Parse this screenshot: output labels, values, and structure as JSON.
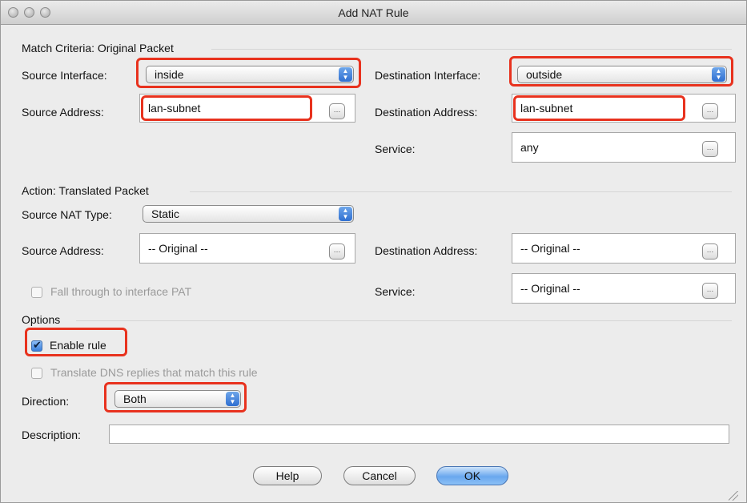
{
  "window": {
    "title": "Add NAT Rule"
  },
  "match": {
    "section_label": "Match Criteria: Original Packet",
    "source_interface_label": "Source Interface:",
    "source_interface_value": "inside",
    "destination_interface_label": "Destination Interface:",
    "destination_interface_value": "outside",
    "source_address_label": "Source Address:",
    "source_address_value": "lan-subnet",
    "destination_address_label": "Destination Address:",
    "destination_address_value": "lan-subnet",
    "service_label": "Service:",
    "service_value": "any"
  },
  "action": {
    "section_label": "Action: Translated Packet",
    "source_nat_type_label": "Source NAT Type:",
    "source_nat_type_value": "Static",
    "source_address_label": "Source Address:",
    "source_address_value": "-- Original --",
    "destination_address_label": "Destination Address:",
    "destination_address_value": "-- Original --",
    "fall_through_label": "Fall through to interface PAT",
    "service_label": "Service:",
    "service_value": "-- Original --"
  },
  "options": {
    "section_label": "Options",
    "enable_rule_label": "Enable rule",
    "enable_rule_checked": true,
    "translate_dns_label": "Translate DNS replies that match this rule",
    "translate_dns_checked": false,
    "direction_label": "Direction:",
    "direction_value": "Both",
    "description_label": "Description:",
    "description_value": ""
  },
  "buttons": {
    "help": "Help",
    "cancel": "Cancel",
    "ok": "OK"
  },
  "icons": {
    "browse": "…",
    "select_arrows": "▲▼"
  },
  "colors": {
    "highlight": "#e8321e",
    "accent": "#3a7fdb"
  }
}
